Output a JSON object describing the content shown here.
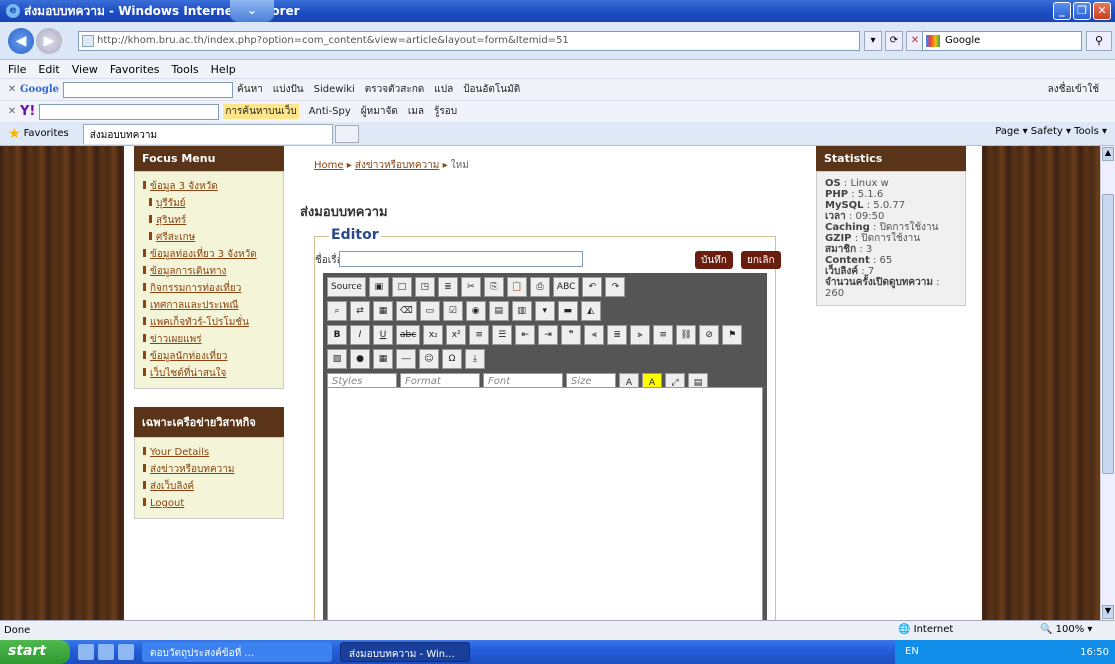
{
  "window": {
    "title": "ส่งมอบบทความ - Windows Internet Explorer"
  },
  "address": {
    "url": "http://khom.bru.ac.th/index.php?option=com_content&view=article&layout=form&Itemid=51",
    "search_engine": "Google"
  },
  "menu": [
    "File",
    "Edit",
    "View",
    "Favorites",
    "Tools",
    "Help"
  ],
  "toolbar1": {
    "google_label": "Google",
    "items": [
      "ค้นหา",
      "แบ่งปัน",
      "Sidewiki",
      "ตรวจตัวสะกด",
      "แปล",
      "ป้อนอัตโนมัติ"
    ],
    "signin": "ลงชื่อเข้าใช้"
  },
  "toolbar2": {
    "items": [
      "การค้นหาบนเว็บ",
      "Anti-Spy",
      "ผู้หมาจัด",
      "เมล",
      "รู้รอบ"
    ]
  },
  "favorites": {
    "label": "Favorites",
    "tab_title": "ส่งมอบบทความ",
    "right": "Page ▾  Safety ▾  Tools ▾"
  },
  "left_menu": {
    "title": "Focus Menu",
    "items": [
      {
        "label": "ข้อมูล 3 จังหวัด",
        "sub": false
      },
      {
        "label": "บุรีรัมย์",
        "sub": true
      },
      {
        "label": "สุรินทร์",
        "sub": true
      },
      {
        "label": "ศรีสะเกษ",
        "sub": true
      },
      {
        "label": "ข้อมูลท่องเที่ยว 3 จังหวัด",
        "sub": false
      },
      {
        "label": "ข้อมูลการเดินทาง",
        "sub": false
      },
      {
        "label": "กิจกรรมการท่องเที่ยว",
        "sub": false
      },
      {
        "label": "เทศกาลและประเพณี",
        "sub": false
      },
      {
        "label": "แพคเก็จทัวร์-โปรโมชั่น",
        "sub": false
      },
      {
        "label": "ข่าวเผยแพร่",
        "sub": false
      },
      {
        "label": "ข้อมูลนักท่องเที่ยว",
        "sub": false
      },
      {
        "label": "เว็บไซต์ที่น่าสนใจ",
        "sub": false
      }
    ]
  },
  "network_menu": {
    "title": "เฉพาะเครือข่ายวิสาหกิจ",
    "items": [
      "Your Details",
      "ส่งข่าวหรือบทความ",
      "ส่งเว็บลิงค์",
      "Logout"
    ]
  },
  "breadcrumb": {
    "home": "Home",
    "section": "ส่งข่าวหรือบทความ",
    "current": "ใหม่"
  },
  "page_title": "ส่งมอบบทความ",
  "editor": {
    "legend": "Editor",
    "title_label": "ชื่อเรื่อง:",
    "save": "บันทึก",
    "cancel": "ยกเลิก",
    "source": "Source",
    "styles": "Styles",
    "format": "Format",
    "font": "Font",
    "size": "Size"
  },
  "statistics": {
    "title": "Statistics",
    "rows": [
      {
        "k": "OS",
        "v": "Linux w"
      },
      {
        "k": "PHP",
        "v": "5.1.6"
      },
      {
        "k": "MySQL",
        "v": "5.0.77"
      },
      {
        "k": "เวลา",
        "v": "09:50"
      },
      {
        "k": "Caching",
        "v": "ปิดการใช้งาน"
      },
      {
        "k": "GZIP",
        "v": "ปิดการใช้งาน"
      },
      {
        "k": "สมาชิก",
        "v": "3"
      },
      {
        "k": "Content",
        "v": "65"
      },
      {
        "k": "เว็บลิงค์",
        "v": "7"
      },
      {
        "k": "จำนวนครั้งเปิดดูบทความ",
        "v": "260"
      }
    ]
  },
  "status": {
    "text": "Done",
    "zone": "Internet",
    "zoom": "100%"
  },
  "taskbar": {
    "start": "start",
    "task1": "ตอบวัตถุประสงค์ข้อที่ ...",
    "task2": "ส่งมอบบทความ - Win...",
    "lang": "EN",
    "time": "16:50"
  }
}
